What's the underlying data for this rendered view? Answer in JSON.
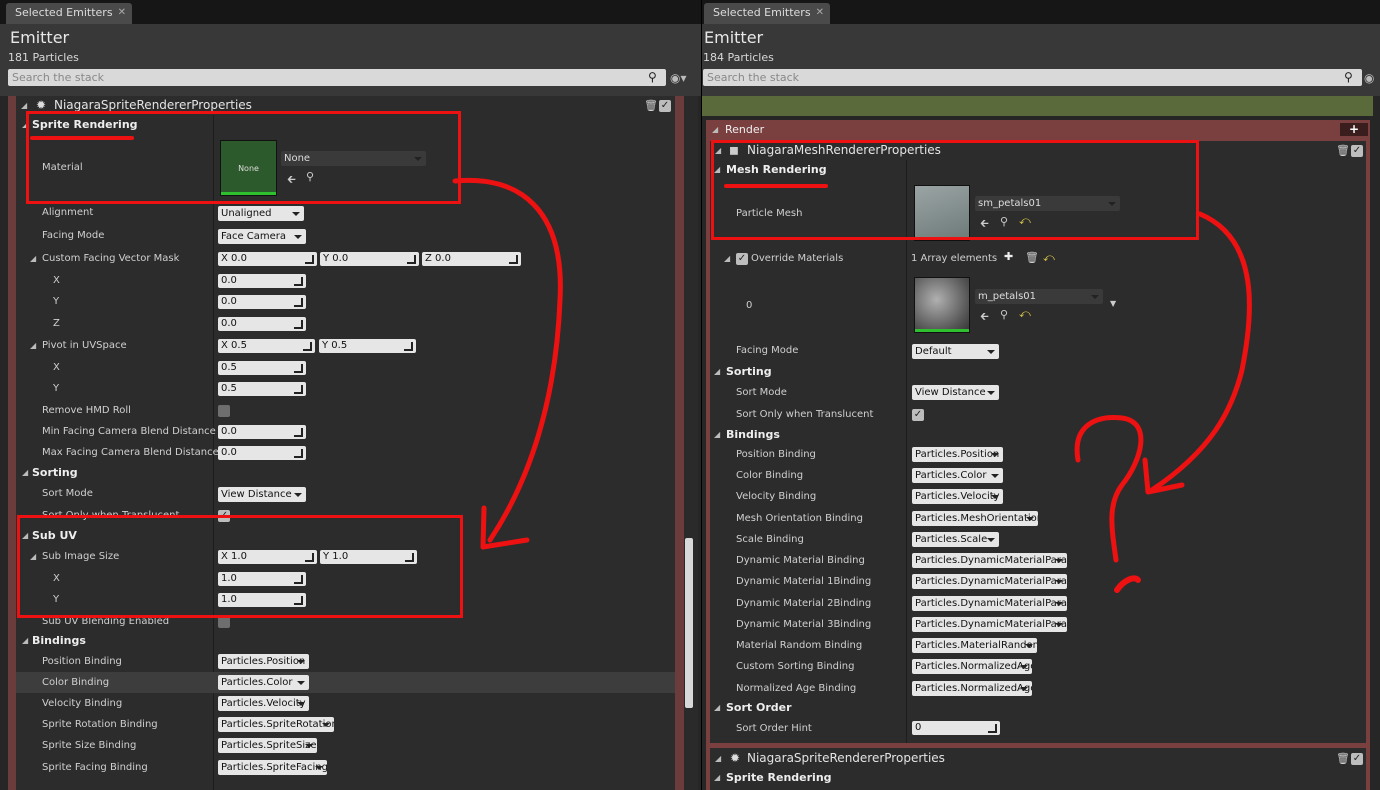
{
  "left": {
    "tab": "Selected Emitters",
    "title": "Emitter",
    "count": "181 Particles",
    "search_placeholder": "Search the stack",
    "renderer": "NiagaraSpriteRendererProperties",
    "sprite_rendering": "Sprite Rendering",
    "material_label": "Material",
    "material_thumb": "None",
    "material_value": "None",
    "alignment": {
      "label": "Alignment",
      "value": "Unaligned"
    },
    "facing": {
      "label": "Facing Mode",
      "value": "Face Camera"
    },
    "cfvm": {
      "label": "Custom Facing Vector Mask",
      "x": "X  0.0",
      "y": "Y  0.0",
      "z": "Z  0.0"
    },
    "x_label": "X",
    "y_label": "Y",
    "z_label": "Z",
    "cfvm_vals": {
      "x": "0.0",
      "y": "0.0",
      "z": "0.0"
    },
    "pivot": {
      "label": "Pivot in UVSpace",
      "x": "X  0.5",
      "y": "Y  0.5",
      "xv": "0.5",
      "yv": "0.5"
    },
    "remove_hmd": "Remove HMD Roll",
    "min_blend": {
      "label": "Min Facing Camera Blend Distance",
      "value": "0.0"
    },
    "max_blend": {
      "label": "Max Facing Camera Blend Distance",
      "value": "0.0"
    },
    "sorting": "Sorting",
    "sort_mode": {
      "label": "Sort Mode",
      "value": "View Distance"
    },
    "sort_translucent": "Sort Only when Translucent",
    "subuv": "Sub UV",
    "sub_image": {
      "label": "Sub Image Size",
      "x": "X  1.0",
      "y": "Y  1.0",
      "xv": "1.0",
      "yv": "1.0"
    },
    "subuv_blend": "Sub UV Blending Enabled",
    "bindings": "Bindings",
    "binding_rows": [
      {
        "label": "Position Binding",
        "value": "Particles.Position"
      },
      {
        "label": "Color Binding",
        "value": "Particles.Color"
      },
      {
        "label": "Velocity Binding",
        "value": "Particles.Velocity"
      },
      {
        "label": "Sprite Rotation Binding",
        "value": "Particles.SpriteRotation"
      },
      {
        "label": "Sprite Size Binding",
        "value": "Particles.SpriteSize"
      },
      {
        "label": "Sprite Facing Binding",
        "value": "Particles.SpriteFacing"
      }
    ]
  },
  "right": {
    "tab": "Selected Emitters",
    "title": "Emitter",
    "count": "184 Particles",
    "search_placeholder": "Search the stack",
    "render": "Render",
    "renderer": "NiagaraMeshRendererProperties",
    "mesh_rendering": "Mesh Rendering",
    "particle_mesh": {
      "label": "Particle Mesh",
      "value": "sm_petals01"
    },
    "override": {
      "label": "Override Materials",
      "count": "1 Array elements"
    },
    "index0": "0",
    "mat0": "m_petals01",
    "facing": {
      "label": "Facing Mode",
      "value": "Default"
    },
    "sorting": "Sorting",
    "sort_mode": {
      "label": "Sort Mode",
      "value": "View Distance"
    },
    "sort_translucent": "Sort Only when Translucent",
    "bindings": "Bindings",
    "binding_rows": [
      {
        "label": "Position Binding",
        "value": "Particles.Position"
      },
      {
        "label": "Color Binding",
        "value": "Particles.Color"
      },
      {
        "label": "Velocity Binding",
        "value": "Particles.Velocity"
      },
      {
        "label": "Mesh Orientation Binding",
        "value": "Particles.MeshOrientation"
      },
      {
        "label": "Scale Binding",
        "value": "Particles.Scale"
      },
      {
        "label": "Dynamic Material Binding",
        "value": "Particles.DynamicMaterialParam"
      },
      {
        "label": "Dynamic Material 1Binding",
        "value": "Particles.DynamicMaterialParam"
      },
      {
        "label": "Dynamic Material 2Binding",
        "value": "Particles.DynamicMaterialParam"
      },
      {
        "label": "Dynamic Material 3Binding",
        "value": "Particles.DynamicMaterialParam"
      },
      {
        "label": "Material Random Binding",
        "value": "Particles.MaterialRandom"
      },
      {
        "label": "Custom Sorting Binding",
        "value": "Particles.NormalizedAge"
      },
      {
        "label": "Normalized Age Binding",
        "value": "Particles.NormalizedAge"
      }
    ],
    "sort_order": "Sort Order",
    "sort_order_hint": {
      "label": "Sort Order Hint",
      "value": "0"
    },
    "sprite_renderer": "NiagaraSpriteRendererProperties",
    "sprite_rendering": "Sprite Rendering"
  },
  "colors": {
    "annotation": "#ee1111",
    "panel": "#262626",
    "header": "#383838"
  }
}
